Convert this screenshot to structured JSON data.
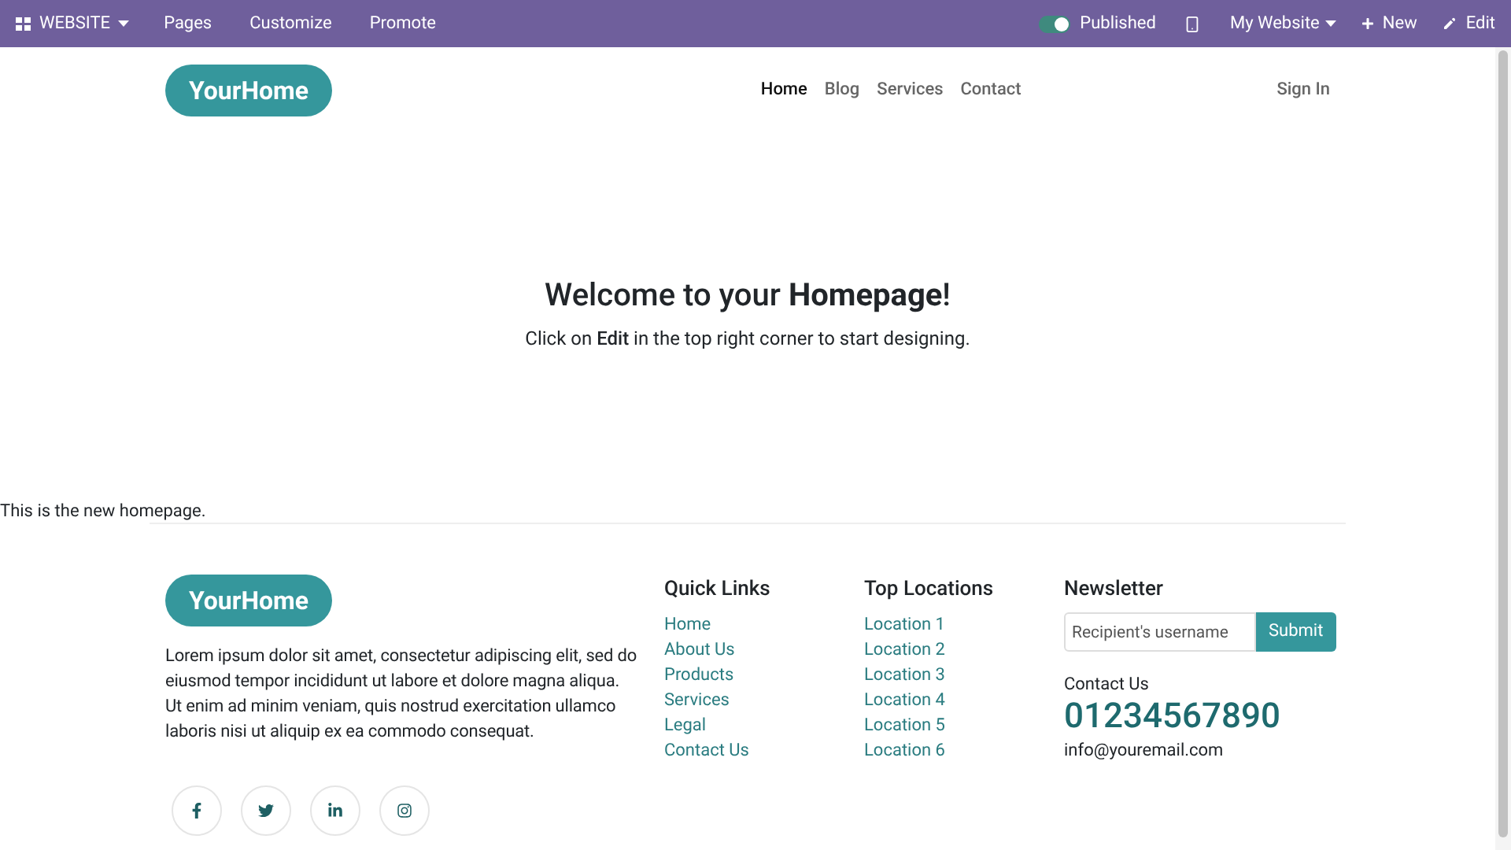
{
  "admin_bar": {
    "app_menu": "WEBSITE",
    "menus": [
      "Pages",
      "Customize",
      "Promote"
    ],
    "published": {
      "label": "Published",
      "on": true
    },
    "website": "My Website",
    "new": "New",
    "edit": "Edit"
  },
  "header": {
    "logo": "YourHome",
    "nav": [
      {
        "label": "Home",
        "selected": true
      },
      {
        "label": "Blog",
        "selected": false
      },
      {
        "label": "Services",
        "selected": false
      },
      {
        "label": "Contact",
        "selected": false
      }
    ],
    "sign_in": "Sign In"
  },
  "hero": {
    "title": "Welcome to your **Homepage**!",
    "subtitle": "Click on **Edit** in the top right corner to start designing."
  },
  "note": "This is the new homepage.",
  "footer": {
    "logo": "YourHome",
    "about": "Lorem ipsum dolor sit amet, consectetur adipiscing elit, sed do eiusmod tempor incididunt ut labore et dolore magna aliqua. Ut enim ad minim veniam, quis nostrud exercitation ullamco laboris nisi ut aliquip ex ea commodo consequat.",
    "socials": [
      {
        "kind": "facebook"
      },
      {
        "kind": "twitter"
      },
      {
        "kind": "linkedin"
      },
      {
        "kind": "instagram"
      }
    ],
    "quick_links": {
      "title": "Quick Links",
      "items": [
        "Home",
        "About Us",
        "Products",
        "Services",
        "Legal",
        "Contact Us"
      ]
    },
    "top_locations": {
      "title": "Top Locations",
      "items": [
        "Location 1",
        "Location 2",
        "Location 3",
        "Location 4",
        "Location 5",
        "Location 6"
      ]
    },
    "newsletter": {
      "title": "Newsletter",
      "placeholder": "Recipient's username",
      "button": "Submit",
      "contact_label": "Contact Us",
      "phone": "01234567890",
      "email": "info@youremail.com"
    }
  }
}
